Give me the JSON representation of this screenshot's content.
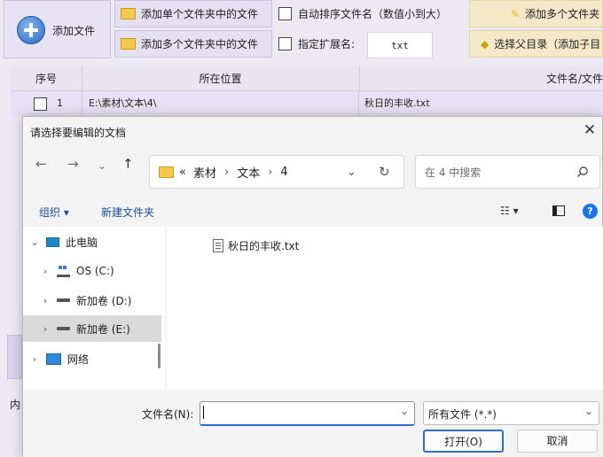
{
  "app": {
    "toolbar": {
      "add_file": "添加文件",
      "add_single_folder": "添加单个文件夹中的文件",
      "add_multi_folder": "添加多个文件夹中的文件",
      "auto_sort": "自动排序文件名（数值小到大）",
      "specify_ext": "指定扩展名:",
      "ext_value": "txt",
      "add_multi_folder_right": "添加多个文件夹",
      "select_parent": "选择父目录（添加子目"
    },
    "table": {
      "headers": [
        "序号",
        "所在位置",
        "文件名/文件"
      ],
      "rows": [
        {
          "index": "1",
          "location": "E:\\素材\\文本\\4\\",
          "filename": "秋日的丰收.txt"
        }
      ]
    },
    "left_fragment": "内"
  },
  "dialog": {
    "title": "请选择要编辑的文档",
    "close": "✕",
    "nav": {
      "back": "←",
      "forward": "→",
      "history": "⌄",
      "up": "↑"
    },
    "address": {
      "overflow": "«",
      "crumbs": [
        "素材",
        "文本",
        "4"
      ],
      "sep": "›",
      "dropdown": "⌄",
      "refresh": "↻"
    },
    "search_placeholder": "在 4 中搜索",
    "commands": {
      "organize": "组织 ▾",
      "new_folder": "新建文件夹",
      "view": "☷ ▾"
    },
    "tree": [
      {
        "label": "此电脑",
        "chevron": "⌄"
      },
      {
        "label": "OS (C:)",
        "chevron": "›"
      },
      {
        "label": "新加卷 (D:)",
        "chevron": "›"
      },
      {
        "label": "新加卷 (E:)",
        "chevron": "›"
      },
      {
        "label": "网络",
        "chevron": "›"
      }
    ],
    "files": [
      {
        "name": "秋日的丰收.txt"
      }
    ],
    "filename_label": "文件名(N):",
    "filename_value": "",
    "filetype_value": "所有文件 (*.*)",
    "open_button": "打开(O)",
    "cancel_button": "取消",
    "colors": {
      "accent": "#2f6fc9",
      "selected_row": "#dadada",
      "help": "#1a73e8"
    }
  }
}
